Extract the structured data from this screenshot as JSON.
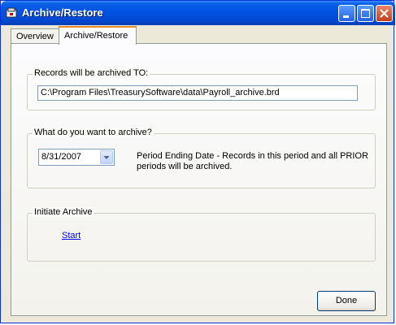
{
  "window": {
    "title": "Archive/Restore"
  },
  "tabs": [
    {
      "label": "Overview"
    },
    {
      "label": "Archive/Restore"
    }
  ],
  "archive_to": {
    "legend": "Records will be archived TO:",
    "path": "C:\\Program Files\\TreasurySoftware\\data\\Payroll_archive.brd"
  },
  "what_to_archive": {
    "legend": "What do you want to archive?",
    "period_value": "8/31/2007",
    "note_line1": "Period Ending Date - Records in this period and all PRIOR",
    "note_line2": "periods will be archived."
  },
  "initiate": {
    "legend": "Initiate Archive",
    "start_link": "Start"
  },
  "footer": {
    "done_label": "Done"
  },
  "colors": {
    "titlebar": "#0054e3",
    "face": "#ece9d8",
    "link": "#0000ff",
    "tab_highlight": "#e68b2c"
  }
}
